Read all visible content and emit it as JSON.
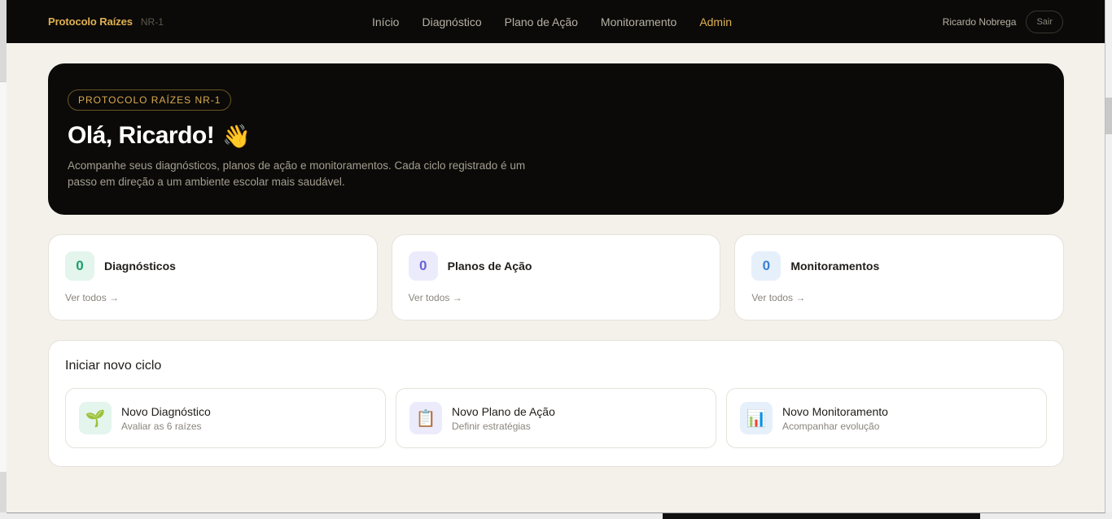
{
  "nav": {
    "brand": "Protocolo Raízes",
    "brand_sub": "NR-1",
    "links": [
      "Início",
      "Diagnóstico",
      "Plano de Ação",
      "Monitoramento",
      "Admin"
    ],
    "user_name": "Ricardo Nobrega",
    "logout_label": "Sair"
  },
  "hero": {
    "badge": "PROTOCOLO RAÍZES NR-1",
    "title": "Olá, Ricardo!",
    "emoji": "👋",
    "description": "Acompanhe seus diagnósticos, planos de ação e monitoramentos. Cada ciclo registrado é um passo em direção a um ambiente escolar mais saudável."
  },
  "stats": [
    {
      "count": "0",
      "label": "Diagnósticos",
      "link": "Ver todos →",
      "color": "#1f9e6b",
      "bg": "#e3f5ec"
    },
    {
      "count": "0",
      "label": "Planos de Ação",
      "link": "Ver todos →",
      "color": "#6a63d9",
      "bg": "#ecebfb"
    },
    {
      "count": "0",
      "label": "Monitoramentos",
      "link": "Ver todos →",
      "color": "#3b7fd4",
      "bg": "#e6f0fb"
    }
  ],
  "cycle": {
    "title": "Iniciar novo ciclo",
    "options": [
      {
        "name": "Novo Diagnóstico",
        "sub": "Avaliar as 6 raízes",
        "icon": "🌱",
        "icon_name": "seedling-icon",
        "bg": "#e3f5ec"
      },
      {
        "name": "Novo Plano de Ação",
        "sub": "Definir estratégias",
        "icon": "📋",
        "icon_name": "clipboard-icon",
        "bg": "#ecebfb"
      },
      {
        "name": "Novo Monitoramento",
        "sub": "Acompanhar evolução",
        "icon": "📊",
        "icon_name": "bar-chart-icon",
        "bg": "#e6f0fb"
      }
    ]
  }
}
